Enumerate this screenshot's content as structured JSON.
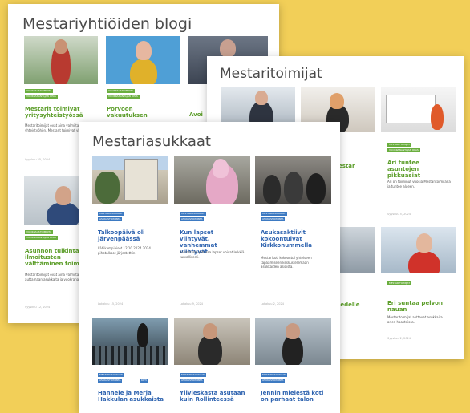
{
  "colors": {
    "background": "#f2cf58",
    "green_badge": "#6aae3e",
    "blue_badge": "#3d7ac2",
    "green_title": "#5d9e2b",
    "blue_title": "#2f64b0"
  },
  "page1": {
    "title": "Mestariyhtiöiden blogi",
    "cards": [
      {
        "badge1": "VUOKRAUSTOIMINTA",
        "badge2": "VUOKRANANTAJAN OPAS",
        "title": "Mestarit toimivat yritysyhteistyössä",
        "excerpt": "Mestaritoimijat ovat aina valmiita yhteistyöhön. Mestarit toimivat yhdessä.",
        "date": "Syyskuu 25, 2024"
      },
      {
        "badge1": "VUOKRAUSTOIMINTA",
        "badge2": "VUOKRANANTAJAN OPAS",
        "title": "Porvoon vakuutuksen",
        "excerpt": "",
        "date": ""
      },
      {
        "badge1": "",
        "badge2": "",
        "title": "Avoi",
        "excerpt": "",
        "date": ""
      },
      {
        "badge1": "VUOKRAUSTOIMINTA",
        "badge2": "VUOKRANANTAJAN OPAS",
        "title": "Asunnon tulkinta ilmoitusten välttäminen toimii",
        "excerpt": "Mestaritoimijat ovat aina valmiita auttamaan asukkaita ja vuokranantajia.",
        "date": "Syyskuu 12, 2024"
      }
    ]
  },
  "page2": {
    "title": "Mestaritoimijat",
    "cards": [
      {
        "badge1": "MESTARITOIMIJAT",
        "badge2": "VUOKRANANTAJAN OPAS",
        "title": "Ari tuntee asuntojen pikkuasiat",
        "excerpt": "Ari on toiminut vuosia Mestaritoimijana ja tuntee alueen.",
        "date": "Syyskuu 5, 2024"
      },
      {
        "badge1": "MESTARITOIMIJAT",
        "badge2": "",
        "title": "Eri suntaa pelvon nauan",
        "excerpt": "Mestaritoimijat auttavat asukkaita arjen haasteissa.",
        "date": "Syyskuu 2, 2024"
      },
      {
        "badge1": "",
        "badge2": "",
        "title": "estar",
        "excerpt": "",
        "date": ""
      },
      {
        "badge1": "",
        "badge2": "",
        "title": "iedelle",
        "excerpt": "",
        "date": ""
      }
    ]
  },
  "page3": {
    "title": "Mestariasukkaat",
    "cards": [
      {
        "badge1": "MESTARIASUKKAAT",
        "badge2": "ASUKASTOIMINTA",
        "title": "Talkoopäivä oli järvenpäässä",
        "excerpt": "Lähikampiaiset 12.10.2024 2024 pihatalkoot järjestettiin",
        "date": "Lokakuu 15, 2024"
      },
      {
        "badge1": "MESTARIASUKKAAT",
        "badge2": "ASUKASTOIMINTA",
        "title": "Kun lapset viihtyvät, vanhemmat viihtyvät",
        "excerpt": "Kerrostalon pihassa lapset voivat leikkiä turvallisesti.",
        "date": "Lokakuu 9, 2024"
      },
      {
        "badge1": "MESTARIASUKKAAT",
        "badge2": "ASUKASTOIMINTA",
        "title": "Asukasaktiivit kokoontuivat Kirkkonummella",
        "excerpt": "Mestarikoti kokoontui yhteiseen tapaamiseen keskustelemaan asukkaiden asioista.",
        "date": "Lokakuu 2, 2024"
      },
      {
        "badge1": "MESTARIASUKKAAT",
        "badge2": "ASUKASTOIMINTA",
        "badge3": "KOTI",
        "title": "Hannele ja Merja Hakkulan asukkaista",
        "excerpt": "",
        "date": ""
      },
      {
        "badge1": "MESTARIASUKKAAT",
        "badge2": "ASUKASTOIMINTA",
        "title": "Ylivieskasta asutaan kuin Rollinteessä",
        "excerpt": "",
        "date": ""
      },
      {
        "badge1": "MESTARIASUKKAAT",
        "badge2": "ASUKASTOIMINTA",
        "title": "Jennin mielestä koti on parhaat talon",
        "excerpt": "",
        "date": ""
      }
    ]
  }
}
